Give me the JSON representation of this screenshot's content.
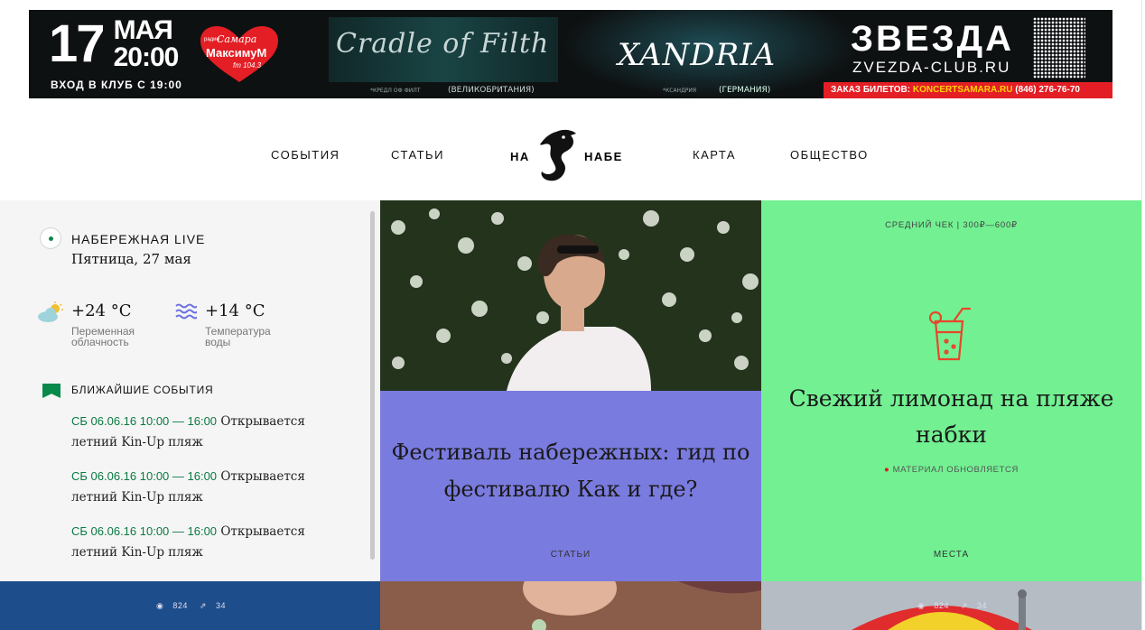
{
  "ad": {
    "day": "17",
    "month": "МАЯ",
    "time": "20:00",
    "entry": "ВХОД В КЛУБ С 19:00",
    "radio_top": "радио",
    "radio_name": "Самара",
    "radio_brand": "МаксимуМ",
    "radio_freq": "fm 104.3",
    "band1": "Cradle of Filth",
    "band1_caption": "*КРЕДЛ ОФ ФИЛТ",
    "band1_country": "(ВЕЛИКОБРИТАНИЯ)",
    "band2": "XANDRIA",
    "band2_caption": "*КСАНДРИЯ",
    "band2_country": "(ГЕРМАНИЯ)",
    "club": "ЗВЕЗДА",
    "club_url": "ZVEZDA-CLUB.RU",
    "tickets_label": "ЗАКАЗ БИЛЕТОВ:",
    "tickets_site": "KONCERTSAMARA.RU",
    "tickets_phone": "(846) 276-76-70"
  },
  "nav": {
    "events": "СОБЫТИЯ",
    "articles": "СТАТЬИ",
    "logo_left": "НА",
    "logo_right": "НАБЕ",
    "map": "КАРТА",
    "society": "ОБЩЕСТВО"
  },
  "sidebar": {
    "live_title": "НАБЕРЕЖНАЯ LIVE",
    "live_date": "Пятница, 27 мая",
    "weather": {
      "air_temp": "+24 °C",
      "air_label_1": "Переменная",
      "air_label_2": "облачность",
      "water_temp": "+14 °C",
      "water_label_1": "Температура",
      "water_label_2": "воды"
    },
    "events_title": "БЛИЖАЙШИЕ СОБЫТИЯ",
    "events": [
      {
        "when": "СБ 06.06.16 10:00 — 16:00",
        "text_1": "Открывается",
        "text_2": "летний Kin-Up пляж"
      },
      {
        "when": "СБ 06.06.16 10:00 — 16:00",
        "text_1": "Открывается",
        "text_2": "летний Kin-Up пляж"
      },
      {
        "when": "СБ 06.06.16 10:00 — 16:00",
        "text_1": "Открывается",
        "text_2": "летний Kin-Up пляж"
      }
    ]
  },
  "tiles": {
    "purple": {
      "title_1": "Фестиваль набережных: гид по",
      "title_2": "фестивалю Как и где?",
      "category": "СТАТЬИ"
    },
    "green": {
      "avg_check": "СРЕДНИЙ ЧЕК | 300₽—600₽",
      "title_1": "Свежий лимонад на пляже",
      "title_2": "набки",
      "status": "МАТЕРИАЛ ОБНОВЛЯЕТСЯ",
      "category": "МЕСТА",
      "icon": "lemonade-glass-icon"
    },
    "blue": {
      "views": "824",
      "shares": "34"
    },
    "right": {
      "views": "824",
      "shares": "34"
    }
  },
  "colors": {
    "accent_green": "#0a8a4a",
    "tile_purple": "#7a7bdf",
    "tile_green": "#72f092",
    "tile_blue": "#1e4d8c"
  }
}
